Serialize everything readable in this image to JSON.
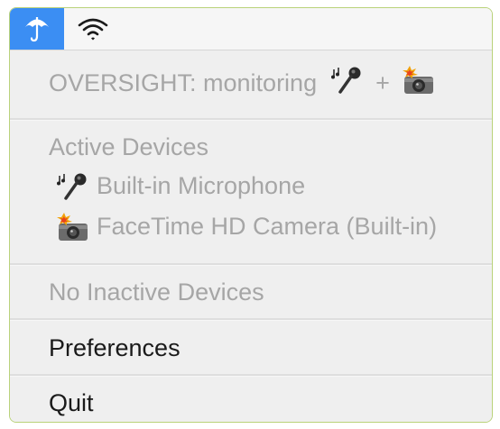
{
  "menubar": {
    "items": [
      {
        "icon": "umbrella-icon",
        "active": true
      },
      {
        "icon": "wifi-icon",
        "active": false
      }
    ],
    "accent_color": "#3b8ef3"
  },
  "menu": {
    "status": {
      "text": "OVERSIGHT: monitoring",
      "joiner": "+",
      "icons": [
        "microphone-icon",
        "camera-icon"
      ]
    },
    "active_devices": {
      "header": "Active Devices",
      "items": [
        {
          "icon": "microphone-icon",
          "label": "Built-in Microphone"
        },
        {
          "icon": "camera-icon",
          "label": "FaceTime HD Camera (Built-in)"
        }
      ]
    },
    "inactive_devices": {
      "header": "No Inactive Devices"
    },
    "preferences_label": "Preferences",
    "quit_label": "Quit"
  }
}
